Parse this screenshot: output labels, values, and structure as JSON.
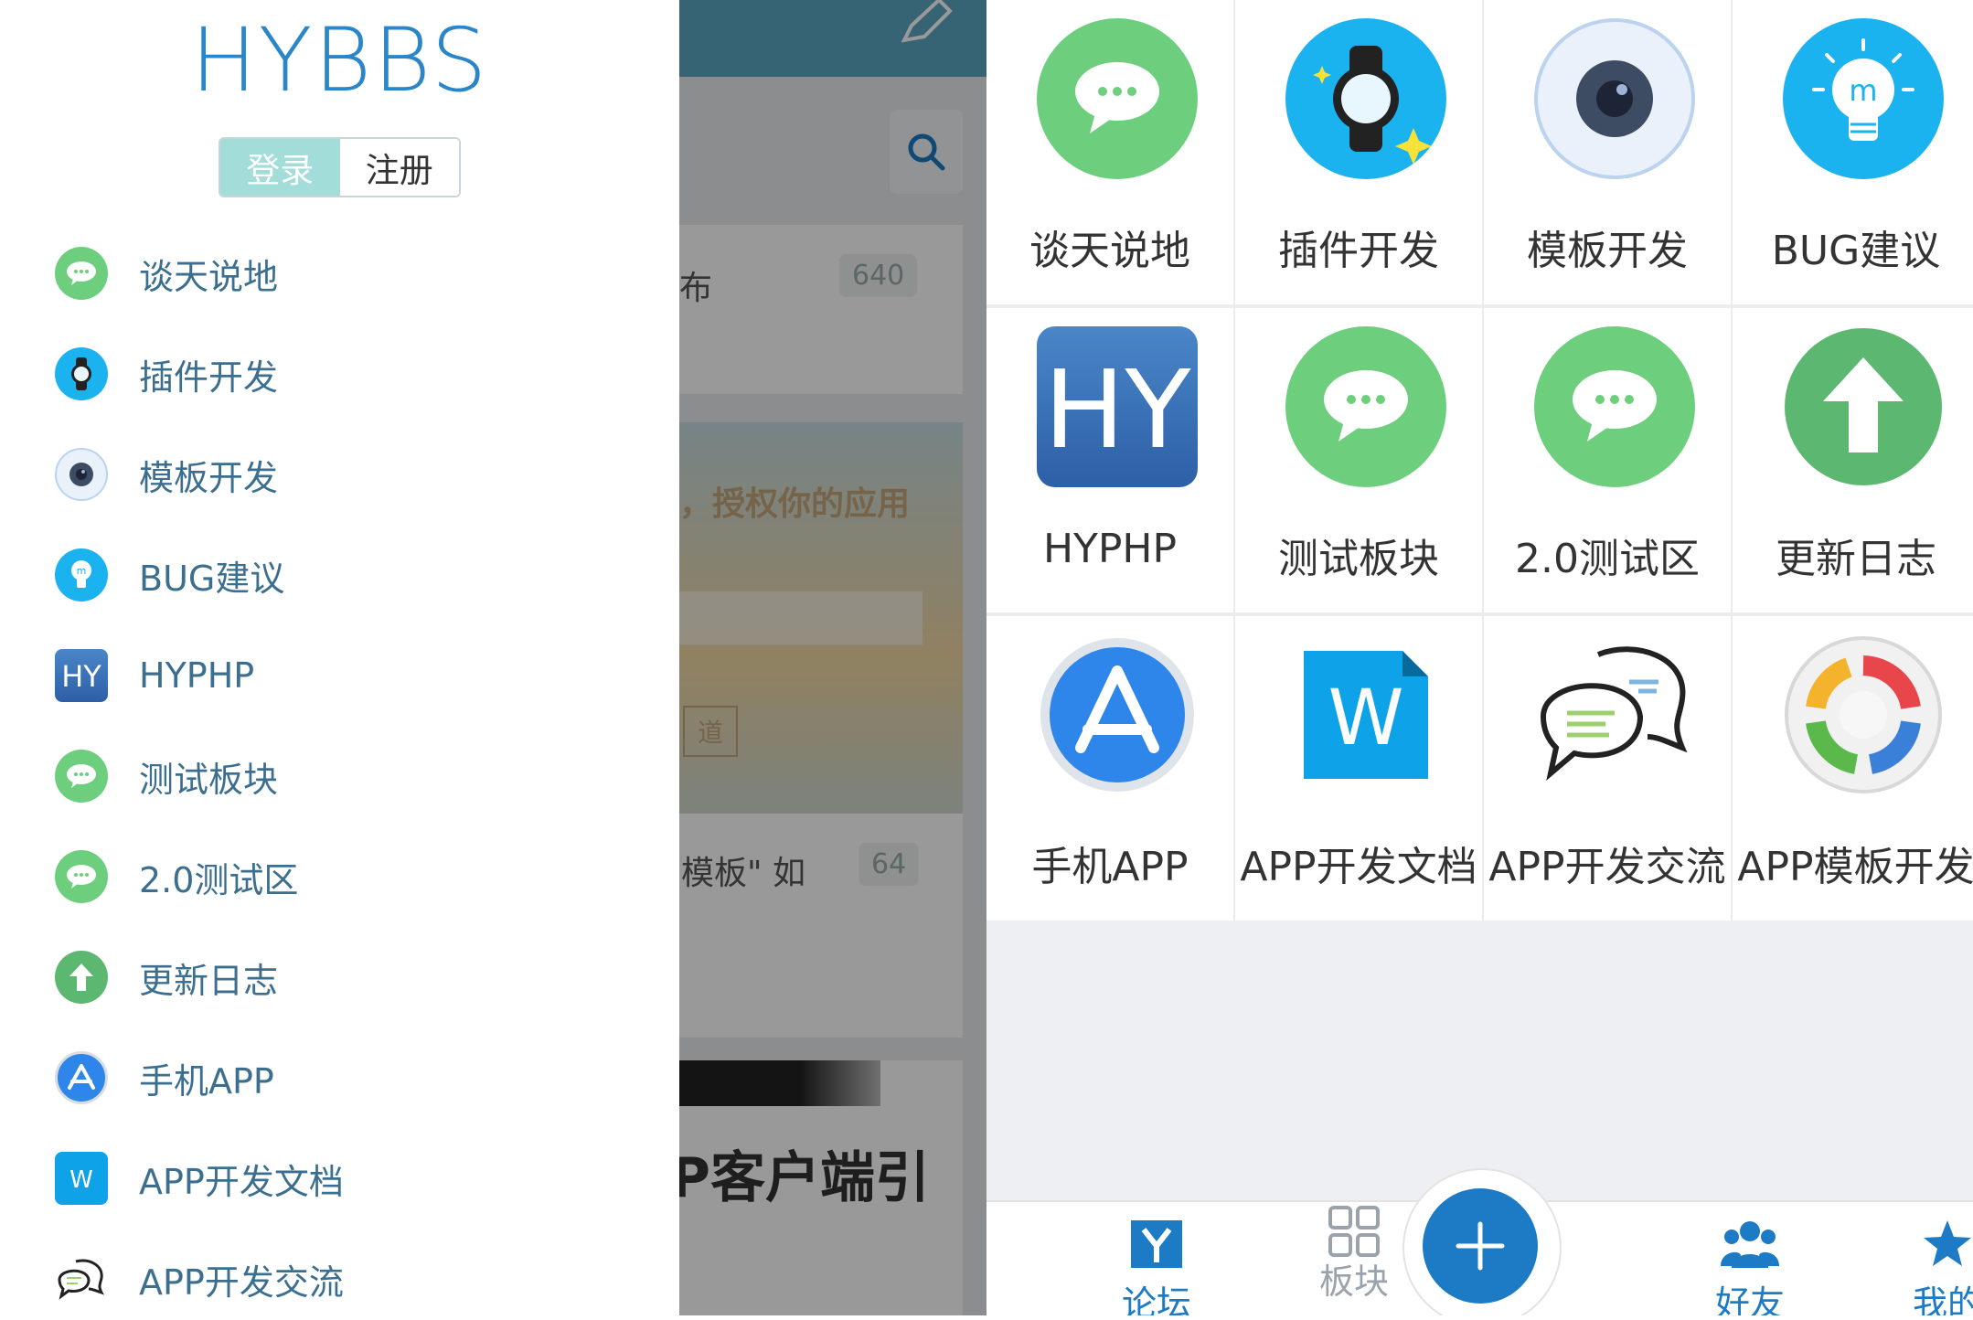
{
  "drawer": {
    "brand": "HYBBS",
    "login_label": "登录",
    "register_label": "注册",
    "items": [
      {
        "label": "谈天说地",
        "icon": "chat-bubble-icon"
      },
      {
        "label": "插件开发",
        "icon": "smartwatch-icon"
      },
      {
        "label": "模板开发",
        "icon": "camera-lens-icon"
      },
      {
        "label": "BUG建议",
        "icon": "lightbulb-icon"
      },
      {
        "label": "HYPHP",
        "icon": "hy-logo-icon"
      },
      {
        "label": "测试板块",
        "icon": "chat-bubble-icon"
      },
      {
        "label": "2.0测试区",
        "icon": "chat-bubble-icon"
      },
      {
        "label": "更新日志",
        "icon": "up-arrow-icon"
      },
      {
        "label": "手机APP",
        "icon": "app-store-icon"
      },
      {
        "label": "APP开发文档",
        "icon": "word-document-icon"
      },
      {
        "label": "APP开发交流",
        "icon": "speech-bubbles-icon"
      }
    ]
  },
  "underlay": {
    "row1_text": "布",
    "row1_count": "640",
    "banner_text": "，授权你的应用",
    "banner_button": "道",
    "row2_text": "模板\" 如",
    "row2_count": "64",
    "bottom_text": "P客户端引"
  },
  "grid": {
    "cells": [
      {
        "label": "谈天说地",
        "icon": "chat-bubble-icon"
      },
      {
        "label": "插件开发",
        "icon": "smartwatch-icon"
      },
      {
        "label": "模板开发",
        "icon": "camera-lens-icon"
      },
      {
        "label": "BUG建议",
        "icon": "lightbulb-icon"
      },
      {
        "label": "HYPHP",
        "icon": "hy-logo-icon"
      },
      {
        "label": "测试板块",
        "icon": "chat-bubble-icon"
      },
      {
        "label": "2.0测试区",
        "icon": "chat-bubble-icon"
      },
      {
        "label": "更新日志",
        "icon": "up-arrow-icon"
      },
      {
        "label": "手机APP",
        "icon": "app-store-icon"
      },
      {
        "label": "APP开发文档",
        "icon": "word-document-icon"
      },
      {
        "label": "APP开发交流",
        "icon": "speech-bubbles-icon"
      },
      {
        "label": "APP模板开发",
        "icon": "refresh-cycle-icon"
      }
    ]
  },
  "tabbar": {
    "tabs": [
      {
        "label": "论坛",
        "icon": "forum-y-icon",
        "active": true
      },
      {
        "label": "板块",
        "icon": "grid-icon",
        "active": false
      },
      {
        "label": "好友",
        "icon": "friends-icon",
        "active": true
      },
      {
        "label": "我的",
        "icon": "star-icon",
        "active": true
      }
    ],
    "fab_icon": "plus-icon"
  },
  "colors": {
    "brand_blue": "#2a86c8",
    "login_teal": "#a3ddd9",
    "chat_green": "#6dcf7d",
    "sky_blue": "#1ab2ef",
    "tab_blue": "#1c7bc4",
    "tab_inactive": "#9aa3ab"
  }
}
